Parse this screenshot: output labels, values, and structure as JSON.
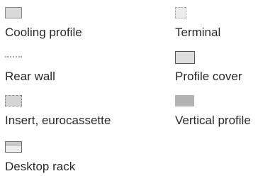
{
  "legend": {
    "items": [
      {
        "id": "cooling",
        "label": "Cooling profile",
        "swatch_icon": "solid-gray-box-icon",
        "fill": "#d9d9d9",
        "stroke": "#8c8c8c"
      },
      {
        "id": "rear",
        "label": "Rear wall",
        "swatch_icon": "dotted-line-icon",
        "stroke": "#a8a8a8"
      },
      {
        "id": "insert",
        "label": "Insert, eurocassette",
        "swatch_icon": "dashed-gray-box-icon",
        "fill": "#d4d4d4",
        "stroke": "#8a8a8a"
      },
      {
        "id": "desktop",
        "label": "Desktop rack",
        "swatch_icon": "split-box-icon",
        "fill": "#ededed",
        "stroke": "#6e6e6e"
      },
      {
        "id": "terminal",
        "label": "Terminal",
        "swatch_icon": "dashed-square-icon",
        "fill": "#ececec",
        "stroke": "#a8a8a8"
      },
      {
        "id": "cover",
        "label": "Profile cover",
        "swatch_icon": "outlined-box-icon",
        "fill": "#dedede",
        "stroke": "#555555"
      },
      {
        "id": "vertical",
        "label": "Vertical profile",
        "swatch_icon": "filled-gray-box-icon",
        "fill": "#b3b3b3"
      }
    ]
  }
}
